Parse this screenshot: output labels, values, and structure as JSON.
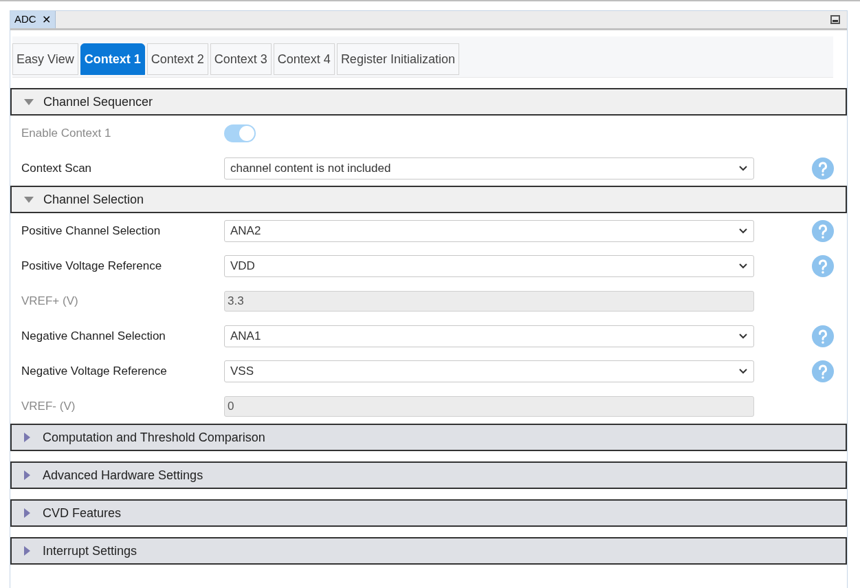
{
  "document_tab": {
    "label": "ADC",
    "close": "✕"
  },
  "tabs": [
    {
      "label": "Easy View",
      "selected": false
    },
    {
      "label": "Context 1",
      "selected": true
    },
    {
      "label": "Context 2",
      "selected": false
    },
    {
      "label": "Context 3",
      "selected": false
    },
    {
      "label": "Context 4",
      "selected": false
    },
    {
      "label": "Register Initialization",
      "selected": false
    }
  ],
  "sections": [
    {
      "title": "Channel Sequencer",
      "expanded": true,
      "rows": [
        {
          "kind": "toggle",
          "label": "Enable Context 1",
          "disabled": true,
          "on": true
        },
        {
          "kind": "select",
          "label": "Context Scan",
          "disabled": false,
          "value": "channel content is not included"
        }
      ]
    },
    {
      "title": "Channel Selection",
      "expanded": true,
      "rows": [
        {
          "kind": "select",
          "label": "Positive Channel Selection",
          "disabled": false,
          "value": "ANA2"
        },
        {
          "kind": "select",
          "label": "Positive Voltage Reference",
          "disabled": false,
          "value": "VDD"
        },
        {
          "kind": "readonly",
          "label": "VREF+ (V)",
          "disabled": true,
          "value": "3.3"
        },
        {
          "kind": "select",
          "label": "Negative Channel Selection",
          "disabled": false,
          "value": "ANA1"
        },
        {
          "kind": "select",
          "label": "Negative Voltage Reference",
          "disabled": false,
          "value": "VSS"
        },
        {
          "kind": "readonly",
          "label": "VREF- (V)",
          "disabled": true,
          "value": "0"
        }
      ]
    },
    {
      "title": "Computation and Threshold Comparison",
      "expanded": false
    },
    {
      "title": "Advanced Hardware Settings",
      "expanded": false
    },
    {
      "title": "CVD Features",
      "expanded": false
    },
    {
      "title": "Interrupt Settings",
      "expanded": false
    }
  ]
}
